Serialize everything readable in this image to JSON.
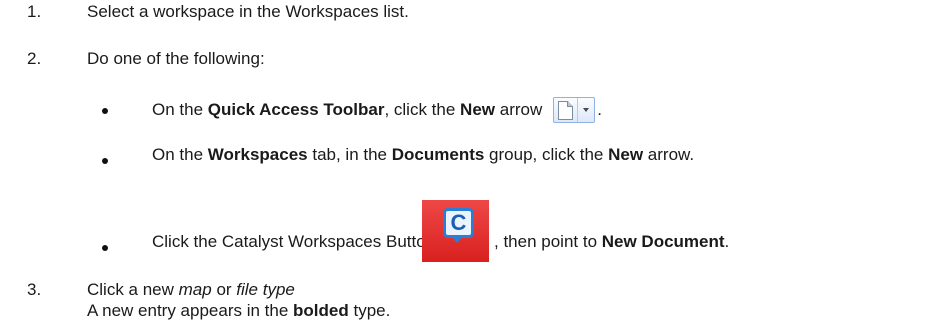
{
  "steps": [
    {
      "num": "1.",
      "text": "Select a workspace in the Workspaces list."
    },
    {
      "num": "2.",
      "text": "Do one of the following:"
    },
    {
      "num": "3.",
      "line1_pre": "Click a new ",
      "line1_em1": "map",
      "line1_mid": " or ",
      "line1_em2": "file type",
      "line2_pre": "A new entry appears in the ",
      "line2_bold": "bolded",
      "line2_post": " type."
    }
  ],
  "bullets": [
    {
      "pre": "On the ",
      "b1": "Quick Access Toolbar",
      "mid": ", click the ",
      "b2": "New",
      "post": " arrow",
      "end": "."
    },
    {
      "pre": "On the ",
      "b1": "Workspaces",
      "mid1": " tab, in the ",
      "b2": "Documents",
      "mid2": " group, click the ",
      "b3": "New",
      "post": " arrow."
    },
    {
      "pre": "Click the Catalyst Workspaces Button",
      "mid": ", then point to ",
      "b1": "New Document",
      "post": "."
    }
  ],
  "icons": {
    "new_document": "new-document-icon",
    "dropdown": "dropdown-arrow-icon",
    "catalyst_button": "catalyst-workspaces-button-icon",
    "catalyst_letter": "C"
  },
  "colors": {
    "catalyst_bg": "#e0302e",
    "catalyst_accent": "#2a7ed6"
  }
}
